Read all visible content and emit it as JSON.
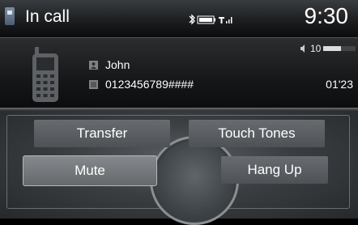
{
  "header": {
    "title": "In call",
    "time": "9:30"
  },
  "call": {
    "contact_name": "John",
    "number": "0123456789####",
    "duration": "01'23",
    "volume_level": "10",
    "volume_fraction": 0.55
  },
  "buttons": {
    "transfer": "Transfer",
    "touch_tones": "Touch Tones",
    "mute": "Mute",
    "hang_up": "Hang Up"
  },
  "colors": {
    "background": "#000000",
    "button": "#5c6064",
    "selected_button": "#75797d",
    "text": "#ffffff"
  }
}
